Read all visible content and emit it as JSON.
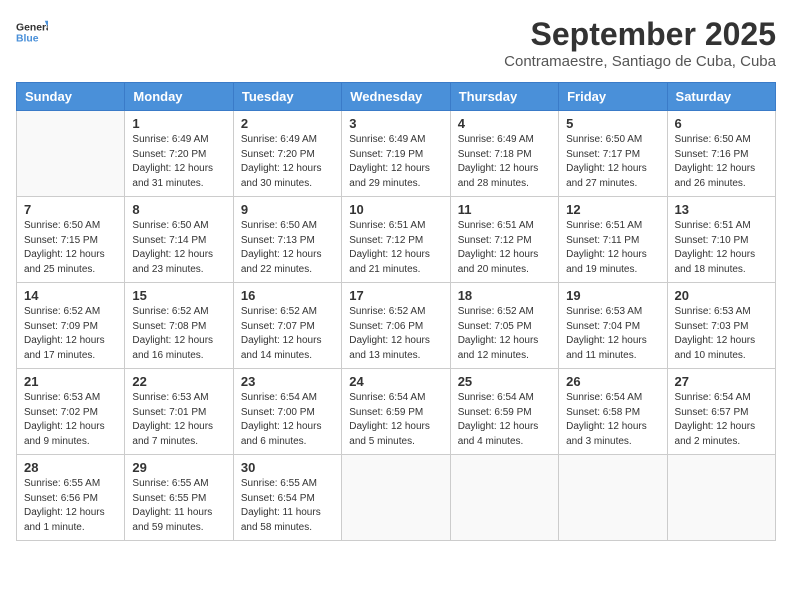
{
  "logo": {
    "general": "General",
    "blue": "Blue"
  },
  "title": "September 2025",
  "location": "Contramaestre, Santiago de Cuba, Cuba",
  "weekdays": [
    "Sunday",
    "Monday",
    "Tuesday",
    "Wednesday",
    "Thursday",
    "Friday",
    "Saturday"
  ],
  "weeks": [
    [
      {
        "day": "",
        "info": ""
      },
      {
        "day": "1",
        "info": "Sunrise: 6:49 AM\nSunset: 7:20 PM\nDaylight: 12 hours\nand 31 minutes."
      },
      {
        "day": "2",
        "info": "Sunrise: 6:49 AM\nSunset: 7:20 PM\nDaylight: 12 hours\nand 30 minutes."
      },
      {
        "day": "3",
        "info": "Sunrise: 6:49 AM\nSunset: 7:19 PM\nDaylight: 12 hours\nand 29 minutes."
      },
      {
        "day": "4",
        "info": "Sunrise: 6:49 AM\nSunset: 7:18 PM\nDaylight: 12 hours\nand 28 minutes."
      },
      {
        "day": "5",
        "info": "Sunrise: 6:50 AM\nSunset: 7:17 PM\nDaylight: 12 hours\nand 27 minutes."
      },
      {
        "day": "6",
        "info": "Sunrise: 6:50 AM\nSunset: 7:16 PM\nDaylight: 12 hours\nand 26 minutes."
      }
    ],
    [
      {
        "day": "7",
        "info": "Sunrise: 6:50 AM\nSunset: 7:15 PM\nDaylight: 12 hours\nand 25 minutes."
      },
      {
        "day": "8",
        "info": "Sunrise: 6:50 AM\nSunset: 7:14 PM\nDaylight: 12 hours\nand 23 minutes."
      },
      {
        "day": "9",
        "info": "Sunrise: 6:50 AM\nSunset: 7:13 PM\nDaylight: 12 hours\nand 22 minutes."
      },
      {
        "day": "10",
        "info": "Sunrise: 6:51 AM\nSunset: 7:12 PM\nDaylight: 12 hours\nand 21 minutes."
      },
      {
        "day": "11",
        "info": "Sunrise: 6:51 AM\nSunset: 7:12 PM\nDaylight: 12 hours\nand 20 minutes."
      },
      {
        "day": "12",
        "info": "Sunrise: 6:51 AM\nSunset: 7:11 PM\nDaylight: 12 hours\nand 19 minutes."
      },
      {
        "day": "13",
        "info": "Sunrise: 6:51 AM\nSunset: 7:10 PM\nDaylight: 12 hours\nand 18 minutes."
      }
    ],
    [
      {
        "day": "14",
        "info": "Sunrise: 6:52 AM\nSunset: 7:09 PM\nDaylight: 12 hours\nand 17 minutes."
      },
      {
        "day": "15",
        "info": "Sunrise: 6:52 AM\nSunset: 7:08 PM\nDaylight: 12 hours\nand 16 minutes."
      },
      {
        "day": "16",
        "info": "Sunrise: 6:52 AM\nSunset: 7:07 PM\nDaylight: 12 hours\nand 14 minutes."
      },
      {
        "day": "17",
        "info": "Sunrise: 6:52 AM\nSunset: 7:06 PM\nDaylight: 12 hours\nand 13 minutes."
      },
      {
        "day": "18",
        "info": "Sunrise: 6:52 AM\nSunset: 7:05 PM\nDaylight: 12 hours\nand 12 minutes."
      },
      {
        "day": "19",
        "info": "Sunrise: 6:53 AM\nSunset: 7:04 PM\nDaylight: 12 hours\nand 11 minutes."
      },
      {
        "day": "20",
        "info": "Sunrise: 6:53 AM\nSunset: 7:03 PM\nDaylight: 12 hours\nand 10 minutes."
      }
    ],
    [
      {
        "day": "21",
        "info": "Sunrise: 6:53 AM\nSunset: 7:02 PM\nDaylight: 12 hours\nand 9 minutes."
      },
      {
        "day": "22",
        "info": "Sunrise: 6:53 AM\nSunset: 7:01 PM\nDaylight: 12 hours\nand 7 minutes."
      },
      {
        "day": "23",
        "info": "Sunrise: 6:54 AM\nSunset: 7:00 PM\nDaylight: 12 hours\nand 6 minutes."
      },
      {
        "day": "24",
        "info": "Sunrise: 6:54 AM\nSunset: 6:59 PM\nDaylight: 12 hours\nand 5 minutes."
      },
      {
        "day": "25",
        "info": "Sunrise: 6:54 AM\nSunset: 6:59 PM\nDaylight: 12 hours\nand 4 minutes."
      },
      {
        "day": "26",
        "info": "Sunrise: 6:54 AM\nSunset: 6:58 PM\nDaylight: 12 hours\nand 3 minutes."
      },
      {
        "day": "27",
        "info": "Sunrise: 6:54 AM\nSunset: 6:57 PM\nDaylight: 12 hours\nand 2 minutes."
      }
    ],
    [
      {
        "day": "28",
        "info": "Sunrise: 6:55 AM\nSunset: 6:56 PM\nDaylight: 12 hours\nand 1 minute."
      },
      {
        "day": "29",
        "info": "Sunrise: 6:55 AM\nSunset: 6:55 PM\nDaylight: 11 hours\nand 59 minutes."
      },
      {
        "day": "30",
        "info": "Sunrise: 6:55 AM\nSunset: 6:54 PM\nDaylight: 11 hours\nand 58 minutes."
      },
      {
        "day": "",
        "info": ""
      },
      {
        "day": "",
        "info": ""
      },
      {
        "day": "",
        "info": ""
      },
      {
        "day": "",
        "info": ""
      }
    ]
  ]
}
